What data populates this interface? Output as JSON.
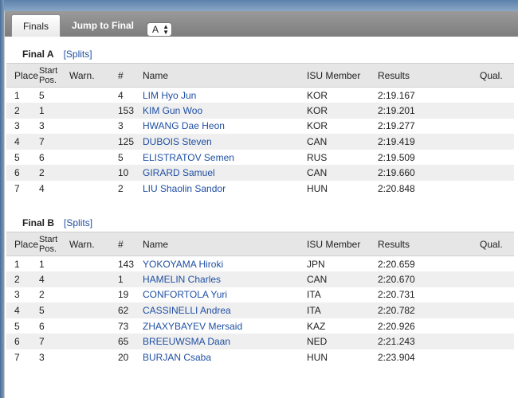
{
  "tabs": {
    "finals_label": "Finals",
    "jump_label": "Jump to Final",
    "select_value": "A"
  },
  "columns": {
    "place": "Place",
    "start_line1": "Start",
    "start_line2": "Pos.",
    "warn": "Warn.",
    "num": "#",
    "name": "Name",
    "isu": "ISU Member",
    "results": "Results",
    "qual": "Qual."
  },
  "finals": [
    {
      "title": "Final A",
      "splits_label": "[Splits]",
      "rows": [
        {
          "place": "1",
          "start": "5",
          "warn": "",
          "num": "4",
          "name": "LIM Hyo Jun",
          "isu": "KOR",
          "result": "2:19.167",
          "qual": ""
        },
        {
          "place": "2",
          "start": "1",
          "warn": "",
          "num": "153",
          "name": "KIM Gun Woo",
          "isu": "KOR",
          "result": "2:19.201",
          "qual": ""
        },
        {
          "place": "3",
          "start": "3",
          "warn": "",
          "num": "3",
          "name": "HWANG Dae Heon",
          "isu": "KOR",
          "result": "2:19.277",
          "qual": ""
        },
        {
          "place": "4",
          "start": "7",
          "warn": "",
          "num": "125",
          "name": "DUBOIS Steven",
          "isu": "CAN",
          "result": "2:19.419",
          "qual": ""
        },
        {
          "place": "5",
          "start": "6",
          "warn": "",
          "num": "5",
          "name": "ELISTRATOV Semen",
          "isu": "RUS",
          "result": "2:19.509",
          "qual": ""
        },
        {
          "place": "6",
          "start": "2",
          "warn": "",
          "num": "10",
          "name": "GIRARD Samuel",
          "isu": "CAN",
          "result": "2:19.660",
          "qual": ""
        },
        {
          "place": "7",
          "start": "4",
          "warn": "",
          "num": "2",
          "name": "LIU Shaolin Sandor",
          "isu": "HUN",
          "result": "2:20.848",
          "qual": ""
        }
      ]
    },
    {
      "title": "Final B",
      "splits_label": "[Splits]",
      "rows": [
        {
          "place": "1",
          "start": "1",
          "warn": "",
          "num": "143",
          "name": "YOKOYAMA Hiroki",
          "isu": "JPN",
          "result": "2:20.659",
          "qual": ""
        },
        {
          "place": "2",
          "start": "4",
          "warn": "",
          "num": "1",
          "name": "HAMELIN Charles",
          "isu": "CAN",
          "result": "2:20.670",
          "qual": ""
        },
        {
          "place": "3",
          "start": "2",
          "warn": "",
          "num": "19",
          "name": "CONFORTOLA Yuri",
          "isu": "ITA",
          "result": "2:20.731",
          "qual": ""
        },
        {
          "place": "4",
          "start": "5",
          "warn": "",
          "num": "62",
          "name": "CASSINELLI Andrea",
          "isu": "ITA",
          "result": "2:20.782",
          "qual": ""
        },
        {
          "place": "5",
          "start": "6",
          "warn": "",
          "num": "73",
          "name": "ZHAXYBAYEV Mersaid",
          "isu": "KAZ",
          "result": "2:20.926",
          "qual": ""
        },
        {
          "place": "6",
          "start": "7",
          "warn": "",
          "num": "65",
          "name": "BREEUWSMA Daan",
          "isu": "NED",
          "result": "2:21.243",
          "qual": ""
        },
        {
          "place": "7",
          "start": "3",
          "warn": "",
          "num": "20",
          "name": "BURJAN Csaba",
          "isu": "HUN",
          "result": "2:23.904",
          "qual": ""
        }
      ]
    }
  ]
}
